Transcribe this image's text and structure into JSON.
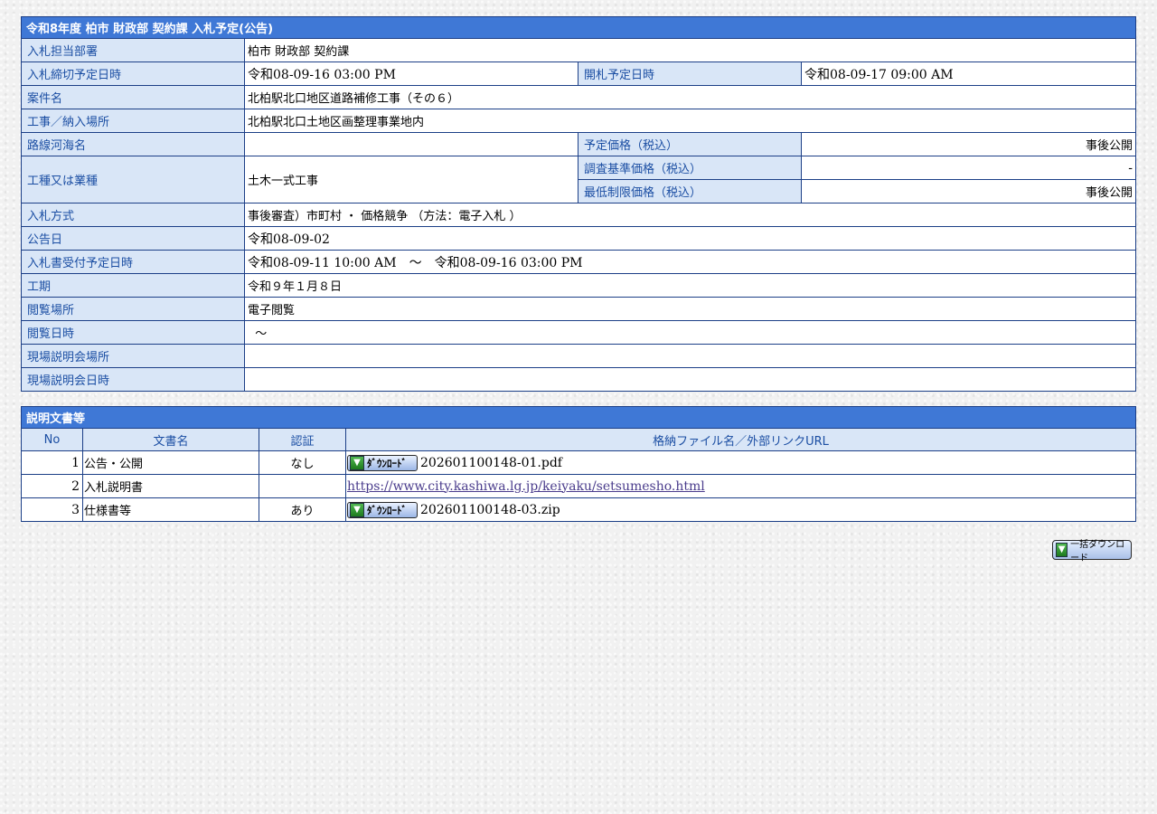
{
  "notice": {
    "title": "令和8年度  柏市  財政部  契約課  入札予定(公告)",
    "rows": {
      "department": {
        "label": "入札担当部署",
        "value": "柏市  財政部  契約課"
      },
      "deadline": {
        "label": "入札締切予定日時",
        "value": "令和08-09-16 03:00 PM"
      },
      "opening": {
        "label": "開札予定日時",
        "value": "令和08-09-17 09:00 AM"
      },
      "project_name": {
        "label": "案件名",
        "value": "北柏駅北口地区道路補修工事（その６）"
      },
      "location": {
        "label": "工事／納入場所",
        "value": "北柏駅北口土地区画整理事業地内"
      },
      "route": {
        "label": "路線河海名",
        "value": ""
      },
      "planned_price": {
        "label": "予定価格（税込）",
        "value": "事後公開"
      },
      "work_type": {
        "label": "工種又は業種",
        "value": "土木一式工事"
      },
      "survey_price": {
        "label": "調査基準価格（税込）",
        "value": "-"
      },
      "min_price": {
        "label": "最低制限価格（税込）",
        "value": "事後公開"
      },
      "method": {
        "label": "入札方式",
        "value": "事後審査）市町村 ・ 価格競争 （方法：電子入札 ）"
      },
      "announce_date": {
        "label": "公告日",
        "value": "令和08-09-02"
      },
      "acceptance": {
        "label": "入札書受付予定日時",
        "value": "令和08-09-11 10:00 AM　～　令和08-09-16 03:00 PM"
      },
      "period": {
        "label": "工期",
        "value": "令和９年１月８日"
      },
      "view_place": {
        "label": "閲覧場所",
        "value": "電子閲覧"
      },
      "view_datetime": {
        "label": "閲覧日時",
        "value": "  ～"
      },
      "site_place": {
        "label": "現場説明会場所",
        "value": ""
      },
      "site_datetime": {
        "label": "現場説明会日時",
        "value": ""
      }
    }
  },
  "documents": {
    "title": "説明文書等",
    "columns": {
      "no": "No",
      "name": "文書名",
      "auth": "認証",
      "file": "格納ファイル名／外部リンクURL"
    },
    "download_label": "ﾀﾞｳﾝﾛｰﾄﾞ",
    "rows": [
      {
        "no": "1",
        "name": "公告・公開",
        "auth": "なし",
        "file": "202601100148-01.pdf"
      },
      {
        "no": "2",
        "name": "入札説明書",
        "auth": "",
        "link": "https://www.city.kashiwa.lg.jp/keiyaku/setsumesho.html"
      },
      {
        "no": "3",
        "name": "仕様書等",
        "auth": "あり",
        "file": "202601100148-03.zip"
      }
    ]
  },
  "bulk_download": {
    "label": "一括ダウンロード"
  },
  "colors": {
    "header_bg": "#3f78d6",
    "label_bg": "#d9e6f7",
    "label_text": "#1b4ea3",
    "border": "#1c3f87"
  }
}
